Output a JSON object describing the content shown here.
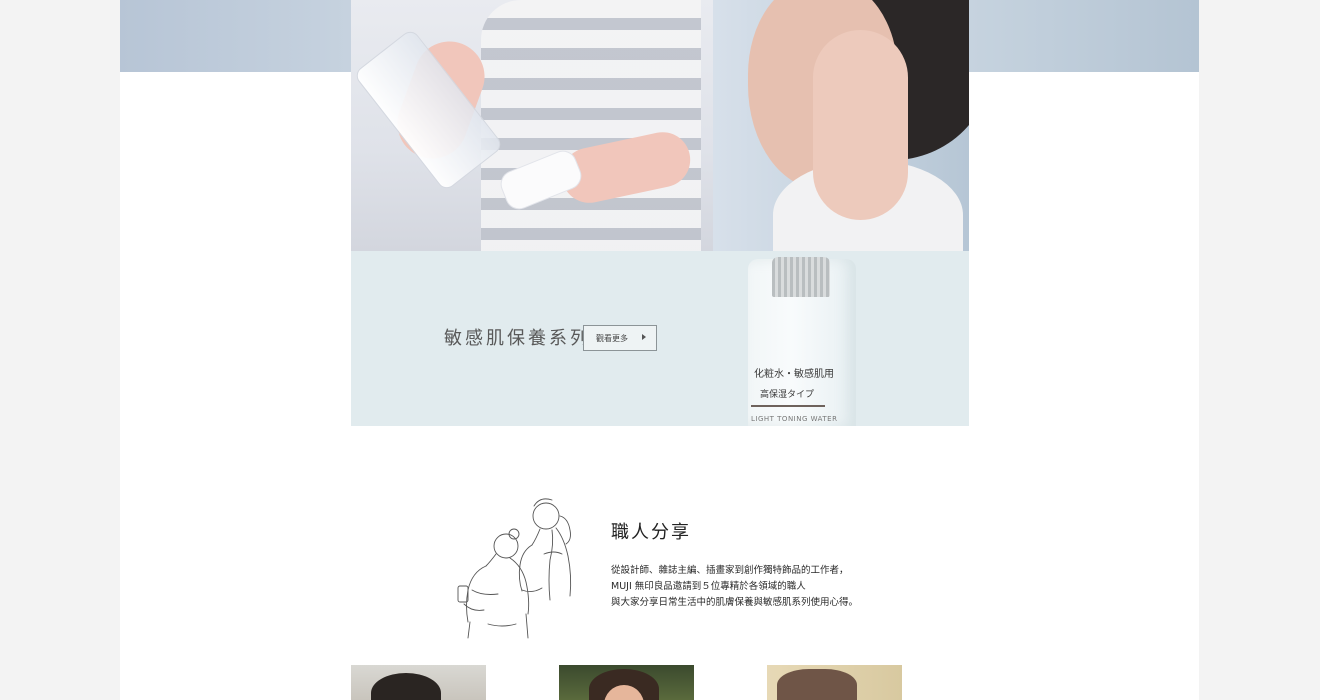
{
  "product": {
    "series_title": "敏感肌保養系列",
    "more_button_label": "觀看更多",
    "bottle_label_line1": "化粧水・敏感肌用",
    "bottle_label_line2": "高保湿タイプ",
    "bottle_label_line3": "LIGHT TONING WATER"
  },
  "artisan": {
    "title": "職人分享",
    "description": [
      "從設計師、雜誌主編、插畫家到創作獨特飾品的工作者，",
      "MUJI 無印良品邀請到５位專精於各領域的職人",
      "與大家分享日常生活中的肌膚保養與敏感肌系列使用心得。"
    ]
  },
  "colors": {
    "banner_blue": "#bccad8",
    "product_band": "#e1ebee",
    "page_bg": "#f3f3f3"
  }
}
